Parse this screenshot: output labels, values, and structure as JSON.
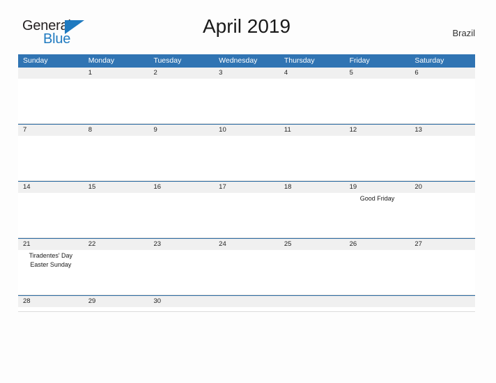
{
  "brand": {
    "name_top": "General",
    "name_bottom": "Blue",
    "triangle_icon": "triangle-icon",
    "color_text": "#231f20",
    "color_accent": "#1f7ac0"
  },
  "header": {
    "title": "April 2019",
    "country": "Brazil"
  },
  "colors": {
    "header_blue": "#3074b3",
    "row_rule": "#2e6da4",
    "date_band": "#f0f0f0",
    "page_background": "#fdfdfd"
  },
  "calendar": {
    "month": "April",
    "year": "2019",
    "weekday_headers": [
      "Sunday",
      "Monday",
      "Tuesday",
      "Wednesday",
      "Thursday",
      "Friday",
      "Saturday"
    ],
    "weeks": [
      {
        "days": [
          {
            "date": "",
            "events": []
          },
          {
            "date": "1",
            "events": []
          },
          {
            "date": "2",
            "events": []
          },
          {
            "date": "3",
            "events": []
          },
          {
            "date": "4",
            "events": []
          },
          {
            "date": "5",
            "events": []
          },
          {
            "date": "6",
            "events": []
          }
        ]
      },
      {
        "days": [
          {
            "date": "7",
            "events": []
          },
          {
            "date": "8",
            "events": []
          },
          {
            "date": "9",
            "events": []
          },
          {
            "date": "10",
            "events": []
          },
          {
            "date": "11",
            "events": []
          },
          {
            "date": "12",
            "events": []
          },
          {
            "date": "13",
            "events": []
          }
        ]
      },
      {
        "days": [
          {
            "date": "14",
            "events": []
          },
          {
            "date": "15",
            "events": []
          },
          {
            "date": "16",
            "events": []
          },
          {
            "date": "17",
            "events": []
          },
          {
            "date": "18",
            "events": []
          },
          {
            "date": "19",
            "events": [
              "Good Friday"
            ]
          },
          {
            "date": "20",
            "events": []
          }
        ]
      },
      {
        "days": [
          {
            "date": "21",
            "events": [
              "Tiradentes' Day",
              "Easter Sunday"
            ]
          },
          {
            "date": "22",
            "events": []
          },
          {
            "date": "23",
            "events": []
          },
          {
            "date": "24",
            "events": []
          },
          {
            "date": "25",
            "events": []
          },
          {
            "date": "26",
            "events": []
          },
          {
            "date": "27",
            "events": []
          }
        ]
      },
      {
        "days": [
          {
            "date": "28",
            "events": []
          },
          {
            "date": "29",
            "events": []
          },
          {
            "date": "30",
            "events": []
          },
          {
            "date": "",
            "events": []
          },
          {
            "date": "",
            "events": []
          },
          {
            "date": "",
            "events": []
          },
          {
            "date": "",
            "events": []
          }
        ]
      }
    ]
  }
}
